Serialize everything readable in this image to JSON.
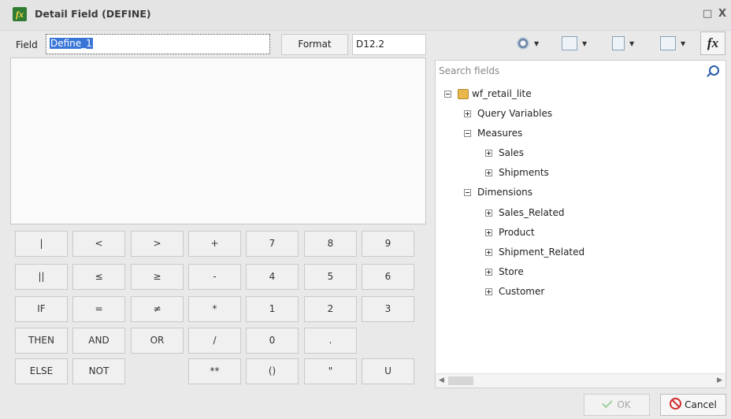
{
  "window": {
    "title": "Detail Field (DEFINE)",
    "maximize_glyph": "□",
    "close_glyph": "X"
  },
  "field": {
    "label": "Field",
    "value": "Define_1"
  },
  "format": {
    "button_label": "Format",
    "value": "D12.2"
  },
  "toolbar": {
    "icons": [
      "gear-icon",
      "chart-icon",
      "list-icon",
      "table-icon",
      "fx-icon"
    ],
    "fx_label": "fx"
  },
  "keypad": {
    "rows": [
      [
        "|",
        "<",
        ">",
        "+",
        "7",
        "8",
        "9"
      ],
      [
        "||",
        "≤",
        "≥",
        "-",
        "4",
        "5",
        "6"
      ],
      [
        "IF",
        "=",
        "≠",
        "*",
        "1",
        "2",
        "3"
      ],
      [
        "THEN",
        "AND",
        "OR",
        "/",
        "0",
        "."
      ],
      [
        "ELSE",
        "NOT",
        "**",
        "()",
        "\"",
        "U"
      ]
    ]
  },
  "search": {
    "placeholder": "Search fields"
  },
  "tree": {
    "root": "wf_retail_lite",
    "nodes": [
      {
        "label": "Query Variables"
      },
      {
        "label": "Measures"
      },
      {
        "label": "Sales"
      },
      {
        "label": "Shipments"
      },
      {
        "label": "Dimensions"
      },
      {
        "label": "Sales_Related"
      },
      {
        "label": "Product"
      },
      {
        "label": "Shipment_Related"
      },
      {
        "label": "Store"
      },
      {
        "label": "Customer"
      }
    ]
  },
  "buttons": {
    "ok": "OK",
    "cancel": "Cancel"
  }
}
